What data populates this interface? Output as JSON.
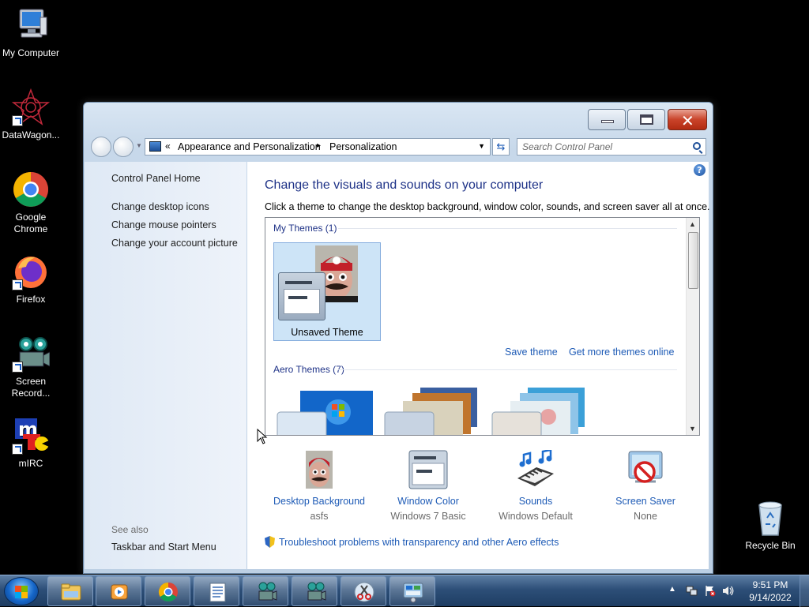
{
  "desktop": {
    "icons": [
      {
        "label": "My Computer"
      },
      {
        "label": "DataWagon..."
      },
      {
        "label": "Google Chrome"
      },
      {
        "label": "Firefox"
      },
      {
        "label": "Screen Record..."
      },
      {
        "label": "mIRC"
      },
      {
        "label": "Recycle Bin"
      }
    ]
  },
  "window": {
    "breadcrumb": {
      "overflow": "«",
      "items": [
        "Appearance and Personalization",
        "Personalization"
      ],
      "separator": "▸"
    },
    "search_placeholder": "Search Control Panel",
    "help_label": "?",
    "sidebar": {
      "links": [
        "Control Panel Home",
        "Change desktop icons",
        "Change mouse pointers",
        "Change your account picture"
      ],
      "see_also_label": "See also",
      "see_also_links": [
        "Taskbar and Start Menu"
      ]
    },
    "content": {
      "heading": "Change the visuals and sounds on your computer",
      "instructions": "Click a theme to change the desktop background, window color, sounds, and screen saver all at once.",
      "my_themes_header": "My Themes (1)",
      "selected_theme": "Unsaved Theme",
      "save_theme": "Save theme",
      "get_more_themes": "Get more themes online",
      "aero_header": "Aero Themes (7)",
      "bottom_items": [
        {
          "label": "Desktop Background",
          "value": "asfs",
          "icon": "photo-icon"
        },
        {
          "label": "Window Color",
          "value": "Windows 7 Basic",
          "icon": "window-color-icon"
        },
        {
          "label": "Sounds",
          "value": "Windows Default",
          "icon": "sounds-icon"
        },
        {
          "label": "Screen Saver",
          "value": "None",
          "icon": "screensaver-icon"
        }
      ],
      "troubleshoot": "Troubleshoot problems with transparency and other Aero effects"
    }
  },
  "taskbar": {
    "clock_time": "9:51 PM",
    "clock_date": "9/14/2022"
  },
  "colors": {
    "link": "#1e5bb6",
    "heading": "#1e3287",
    "selection": "#cde4f7"
  }
}
